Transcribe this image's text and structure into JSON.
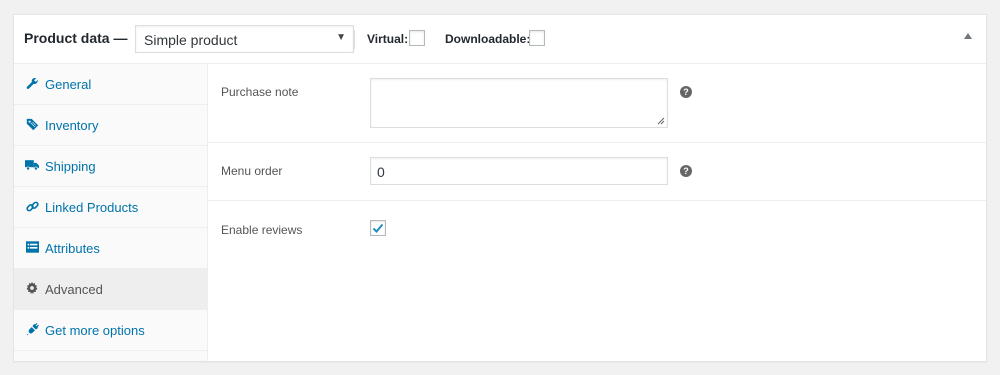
{
  "header": {
    "title": "Product data —",
    "product_type": "Simple product",
    "virtual_label": "Virtual:",
    "downloadable_label": "Downloadable:",
    "virtual_checked": false,
    "downloadable_checked": false
  },
  "tabs": [
    {
      "label": "General",
      "icon": "wrench-icon"
    },
    {
      "label": "Inventory",
      "icon": "tag-icon"
    },
    {
      "label": "Shipping",
      "icon": "truck-icon"
    },
    {
      "label": "Linked Products",
      "icon": "link-icon"
    },
    {
      "label": "Attributes",
      "icon": "list-icon"
    },
    {
      "label": "Advanced",
      "icon": "gear-icon",
      "active": true
    },
    {
      "label": "Get more options",
      "icon": "plug-icon"
    }
  ],
  "fields": {
    "purchase_note_label": "Purchase note",
    "purchase_note_value": "",
    "menu_order_label": "Menu order",
    "menu_order_value": "0",
    "enable_reviews_label": "Enable reviews",
    "enable_reviews_checked": true,
    "help_glyph": "?"
  },
  "colors": {
    "link": "#0073aa",
    "active_tab_bg": "#eeeeee",
    "check": "#1e8cbe"
  }
}
